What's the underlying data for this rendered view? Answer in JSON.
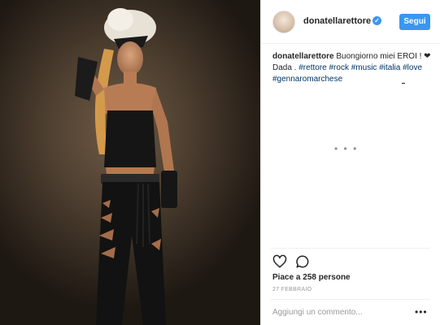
{
  "post": {
    "username": "donatellarettore",
    "verified_glyph": "✓",
    "follow_label": "Segui",
    "caption_user": "donatellarettore",
    "caption_text": " Buongiorno miei EROI ! ❤ Dada . ",
    "hashtags": [
      "#rettore",
      "#rock",
      "#music",
      "#italia",
      "#love",
      "#gennaromarchese"
    ],
    "loading_dots": "• • •",
    "likes": "Piace a 258 persone",
    "date": "27 FEBBRAIO",
    "comment_placeholder": "Aggiungi un commento...",
    "more_options": "•••"
  },
  "icons": {
    "like": "heart-icon",
    "comment": "comment-icon",
    "verified": "verified-badge-icon"
  },
  "colors": {
    "accent": "#3897f0",
    "text": "#262626",
    "muted": "#999999",
    "hashtag": "#003569"
  }
}
